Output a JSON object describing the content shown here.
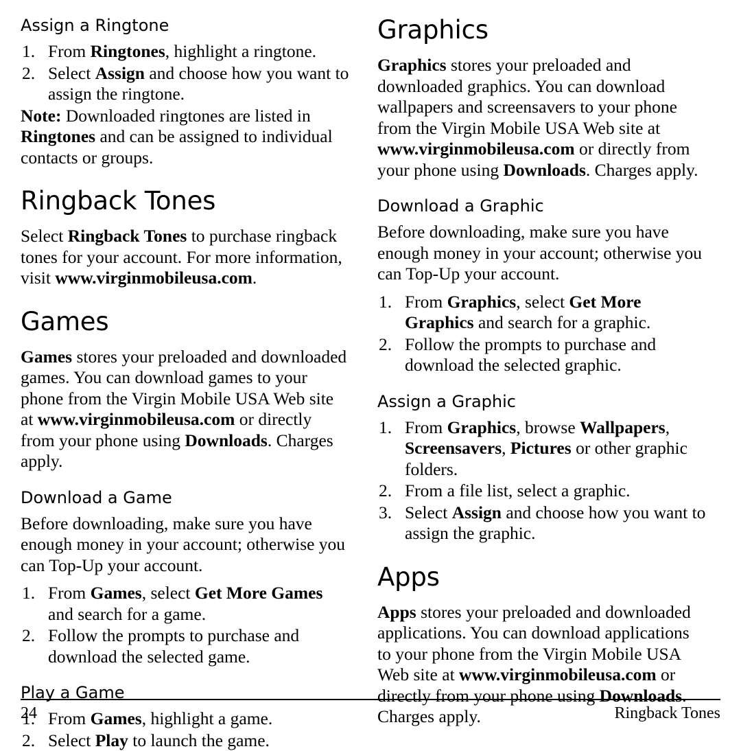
{
  "page": {
    "number": "24",
    "footer_right": "Ringback Tones"
  },
  "left_column": {
    "assign_ringtone": {
      "heading": "Assign a Ringtone",
      "steps": [
        {
          "pre": "From ",
          "bold1": "Ringtones",
          "post": ", highlight a ringtone."
        },
        {
          "pre": "Select ",
          "bold1": "Assign",
          "post": " and choose how you want to assign the ringtone."
        }
      ],
      "note_label": "Note:",
      "note_part1": " Downloaded ringtones are listed in ",
      "note_bold": "Ringtones",
      "note_part2": " and can be assigned to individual contacts or groups."
    },
    "ringback_tones": {
      "heading": "Ringback Tones",
      "p1_pre": "Select ",
      "p1_bold": "Ringback Tones",
      "p1_mid": " to purchase ringback tones for your account. For more information, visit ",
      "p1_bold2": "www.virginmobileusa.com",
      "p1_post": "."
    },
    "games": {
      "heading": "Games",
      "p1_bold": "Games",
      "p1_mid": " stores your preloaded and downloaded games. You can download games to your phone from the Virgin Mobile USA Web site at ",
      "p1_bold2": "www.virginmobileusa.com",
      "p1_mid2": " or directly from your phone using ",
      "p1_bold3": "Downloads",
      "p1_post": ". Charges apply."
    },
    "download_game": {
      "heading": "Download a Game",
      "p1": "Before downloading, make sure you have enough money in your account; otherwise you can Top-Up your account.",
      "steps": [
        {
          "pre": "From ",
          "bold1": "Games",
          "mid": ", select ",
          "bold2": "Get More Games",
          "post": " and search for a game."
        },
        {
          "pre": "Follow the prompts to purchase and download the selected game.",
          "bold1": "",
          "post": ""
        }
      ]
    },
    "play_game": {
      "heading": "Play a Game",
      "steps": [
        {
          "pre": "From ",
          "bold1": "Games",
          "post": ", highlight a game."
        },
        {
          "pre": "Select ",
          "bold1": "Play",
          "post": " to launch the game."
        }
      ]
    }
  },
  "right_column": {
    "graphics": {
      "heading": "Graphics",
      "p1_bold": "Graphics",
      "p1_mid": " stores your preloaded and downloaded graphics. You can download wallpapers and screensavers to your phone from the Virgin Mobile USA Web site at ",
      "p1_bold2": "www.virginmobileusa.com",
      "p1_mid2": " or directly from your phone using ",
      "p1_bold3": "Downloads",
      "p1_post": ". Charges apply."
    },
    "download_graphic": {
      "heading": "Download a Graphic",
      "p1": "Before downloading, make sure you have enough money in your account; otherwise you can Top-Up your account.",
      "steps": [
        {
          "pre": "From ",
          "bold1": "Graphics",
          "mid": ", select ",
          "bold2": "Get More Graphics",
          "post": " and search for a graphic."
        },
        {
          "pre": "Follow the prompts to purchase and download the selected graphic.",
          "bold1": "",
          "post": ""
        }
      ]
    },
    "assign_graphic": {
      "heading": "Assign a Graphic",
      "steps": [
        {
          "pre": "From ",
          "bold1": "Graphics",
          "mid": ", browse ",
          "bold2": "Wallpapers",
          "mid2": ", ",
          "bold3": "Screensavers",
          "mid3": ", ",
          "bold4": "Pictures",
          "post": " or other graphic folders."
        },
        {
          "pre": "From a file list, select a graphic.",
          "post": ""
        },
        {
          "pre": "Select ",
          "bold1": "Assign",
          "post": " and choose how you want to assign the graphic."
        }
      ]
    },
    "apps": {
      "heading": "Apps",
      "p1_bold": "Apps",
      "p1_mid": " stores your preloaded and downloaded applications. You can download applications to your phone from the Virgin Mobile USA Web site at ",
      "p1_bold2": "www.virginmobileusa.com",
      "p1_mid2": " or directly from your phone using ",
      "p1_bold3": "Downloads",
      "p1_post": ". Charges apply."
    }
  }
}
